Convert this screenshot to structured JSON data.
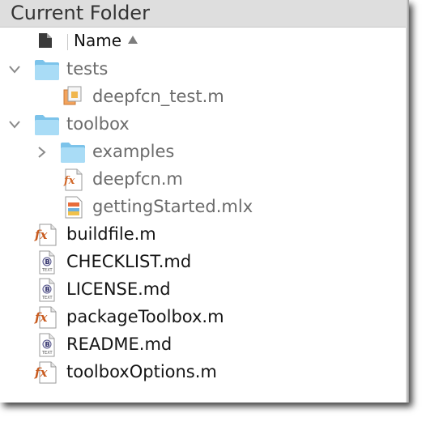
{
  "panel": {
    "title": "Current Folder",
    "column_header": "Name"
  },
  "tree": [
    {
      "label": "tests",
      "icon": "folder-icon",
      "expanded": true
    },
    {
      "label": "deepfcn_test.m",
      "icon": "matlab-test-class-icon"
    },
    {
      "label": "toolbox",
      "icon": "folder-icon",
      "expanded": true
    },
    {
      "label": "examples",
      "icon": "folder-icon",
      "expanded": false
    },
    {
      "label": "deepfcn.m",
      "icon": "matlab-function-icon"
    },
    {
      "label": "gettingStarted.mlx",
      "icon": "live-script-icon"
    },
    {
      "label": "buildfile.m",
      "icon": "matlab-function-icon"
    },
    {
      "label": "CHECKLIST.md",
      "icon": "text-file-icon"
    },
    {
      "label": "LICENSE.md",
      "icon": "text-file-icon"
    },
    {
      "label": "packageToolbox.m",
      "icon": "matlab-function-icon"
    },
    {
      "label": "README.md",
      "icon": "text-file-icon"
    },
    {
      "label": "toolboxOptions.m",
      "icon": "matlab-function-icon"
    }
  ]
}
